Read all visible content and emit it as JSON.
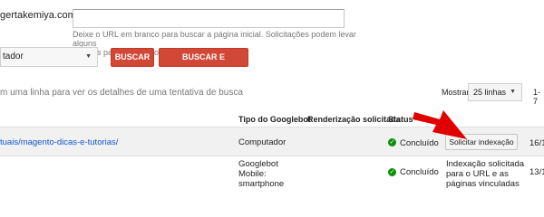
{
  "fetch": {
    "url_prefix": "gertakemiya.com.br/",
    "url_value": "",
    "helper_text_line1": "Deixe o URL em branco para buscar a página inicial. Solicitações podem levar alguns",
    "helper_text_line2": "minutos para serem processadas.",
    "device_selected": "tador",
    "buscar_label": "BUSCAR",
    "buscar_renderizar_label": "BUSCAR E RENDERIZAR"
  },
  "table_controls": {
    "hint": "m uma linha para ver os detalhes de uma tentativa de busca",
    "mostrar_label": "Mostrar",
    "rows_per_page": "25 linhas",
    "pager": "1-7"
  },
  "table": {
    "headers": {
      "googlebot": "Tipo do Googlebot",
      "render": "Renderização solicitada",
      "status": "Status"
    },
    "rows": [
      {
        "path": "tuais/magento-dicas-e-tutorias/",
        "googlebot": "Computador",
        "status": "Concluído",
        "action_label": "Solicitar indexação",
        "date": "16/1"
      },
      {
        "googlebot_lines": [
          "Googlebot",
          "Mobile:",
          "smartphone"
        ],
        "status": "Concluído",
        "action_lines": [
          "Indexação solicitada",
          "para o URL e as",
          "páginas vinculadas"
        ],
        "date": "13/1"
      }
    ]
  },
  "annotation": {
    "arrow_color": "#e00000"
  },
  "colors": {
    "accent_red": "#d14836",
    "link_blue": "#1155cc",
    "success_green": "#0a8f08"
  }
}
